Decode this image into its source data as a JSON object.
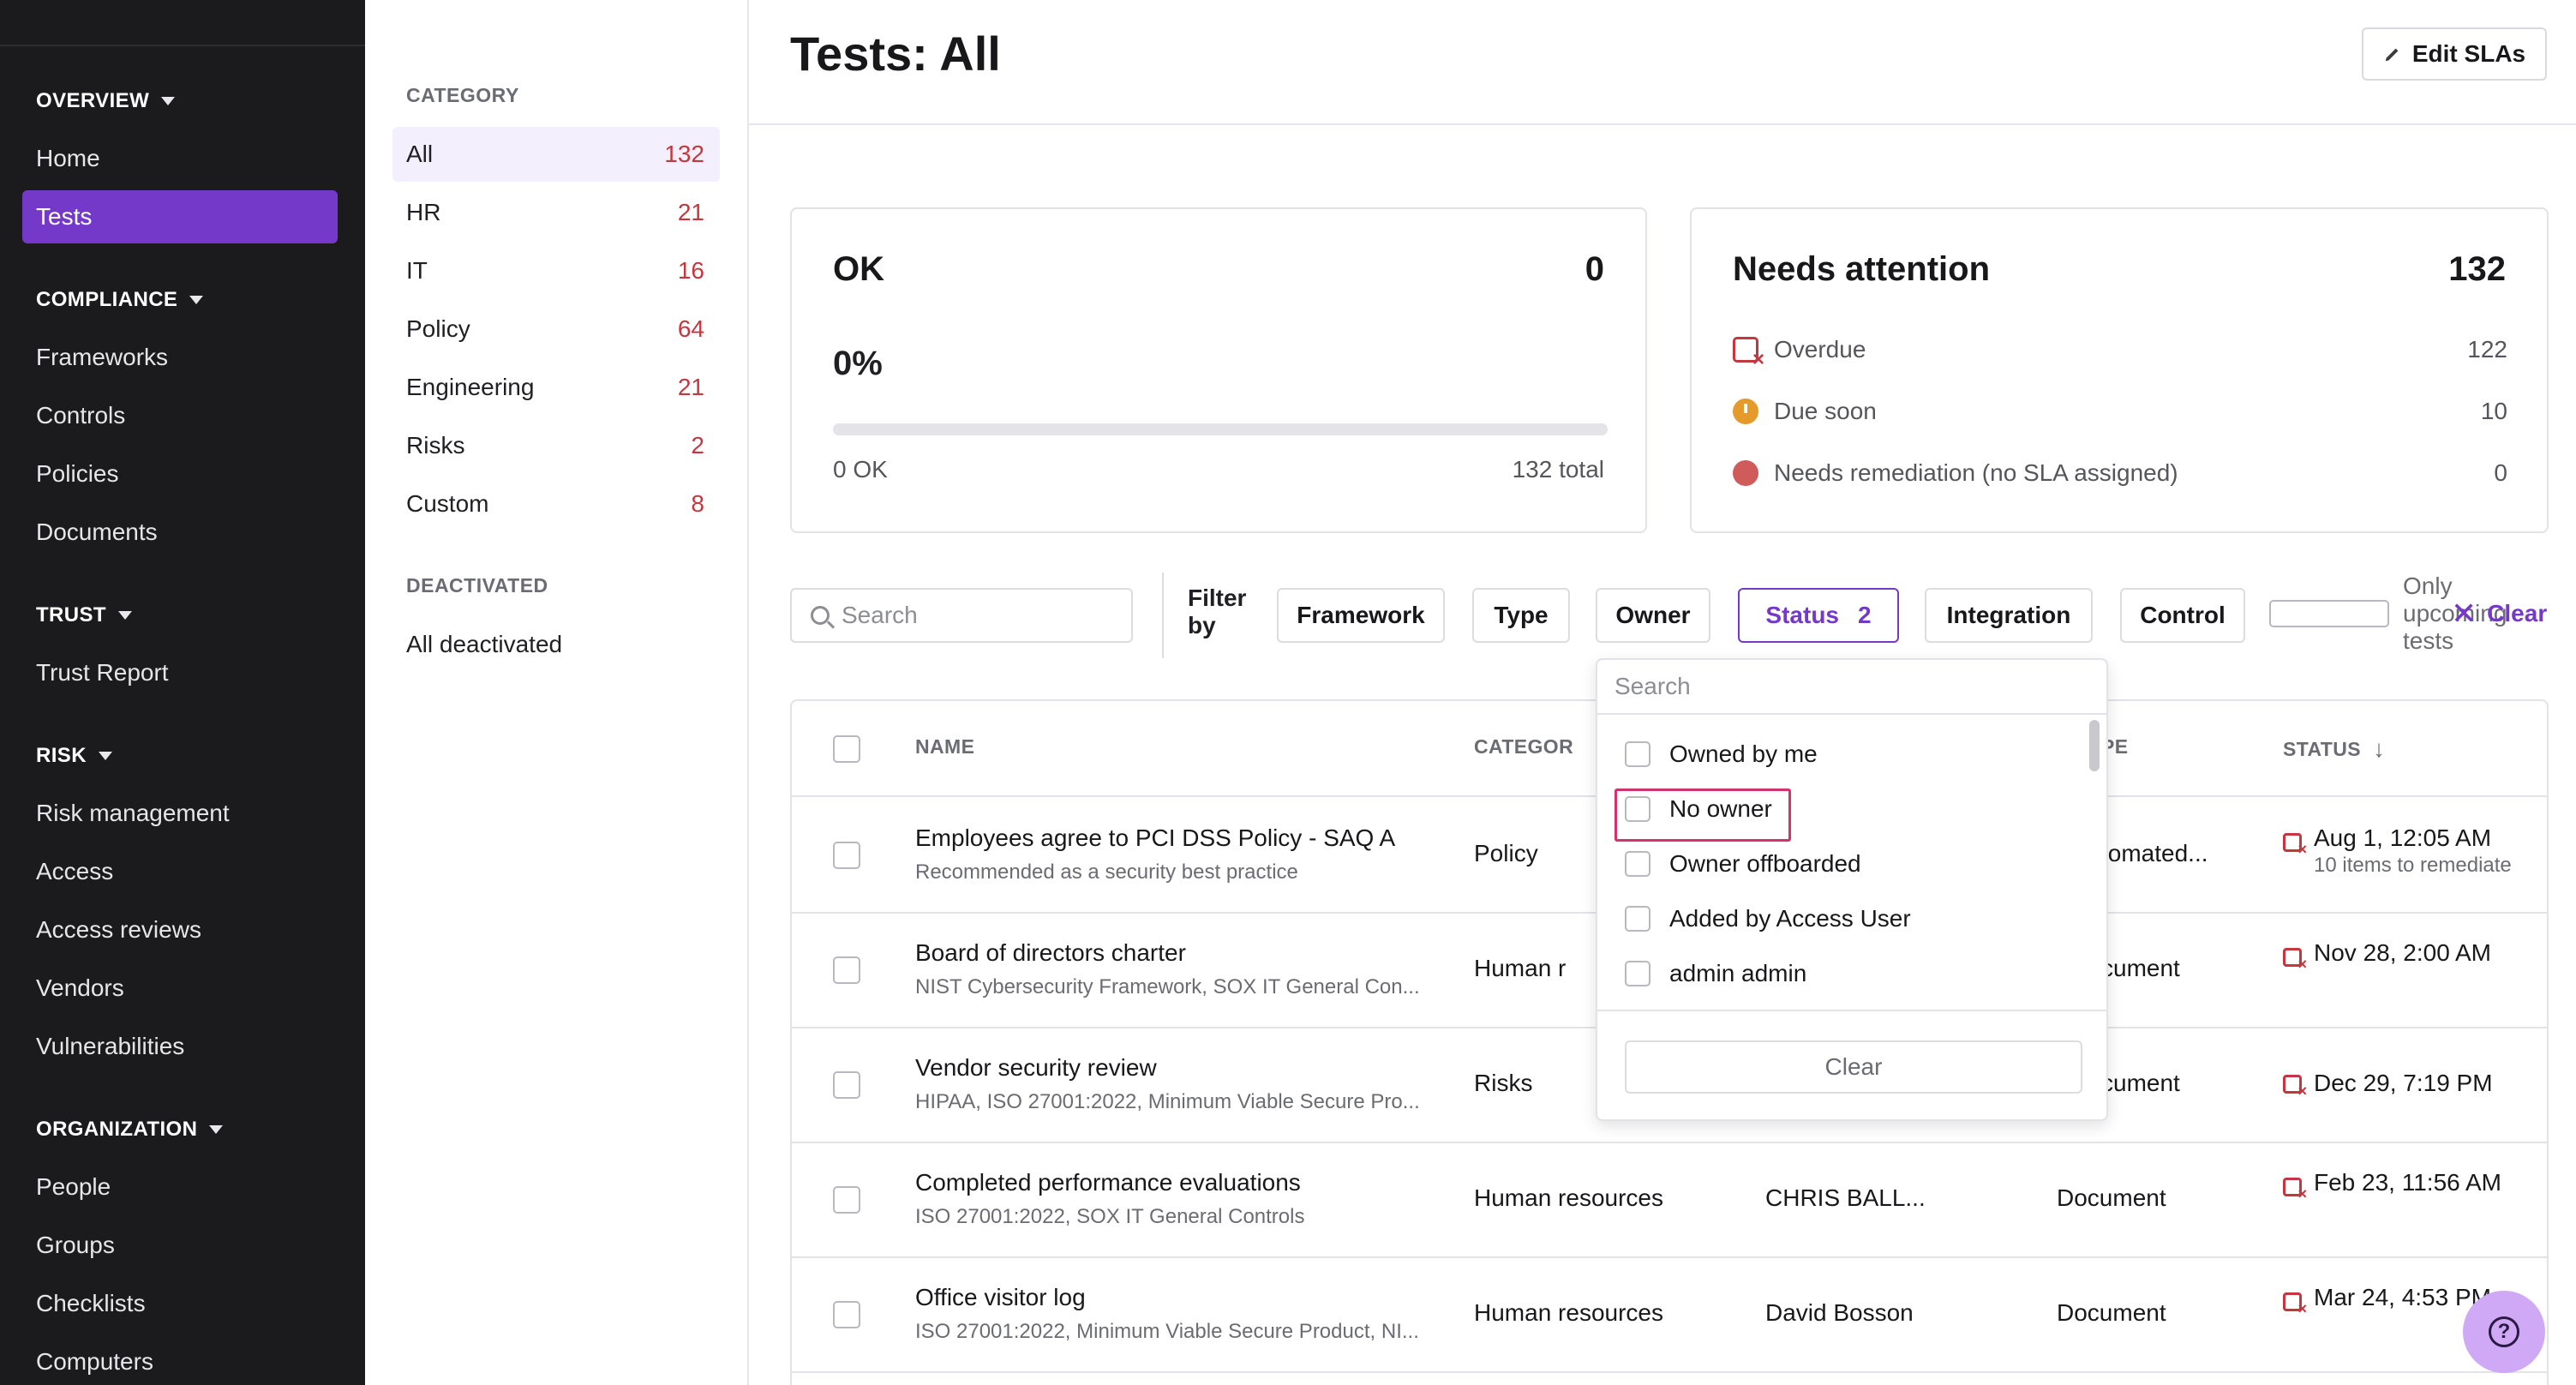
{
  "sidebar": {
    "sections": [
      {
        "title": "OVERVIEW",
        "items": [
          "Home",
          "Tests"
        ]
      },
      {
        "title": "COMPLIANCE",
        "items": [
          "Frameworks",
          "Controls",
          "Policies",
          "Documents"
        ]
      },
      {
        "title": "TRUST",
        "items": [
          "Trust Report"
        ]
      },
      {
        "title": "RISK",
        "items": [
          "Risk management",
          "Access",
          "Access reviews",
          "Vendors",
          "Vulnerabilities"
        ]
      },
      {
        "title": "ORGANIZATION",
        "items": [
          "People",
          "Groups",
          "Checklists",
          "Computers"
        ]
      }
    ],
    "active_item": "Tests"
  },
  "categories": {
    "heading": "CATEGORY",
    "items": [
      {
        "label": "All",
        "count": "132"
      },
      {
        "label": "HR",
        "count": "21"
      },
      {
        "label": "IT",
        "count": "16"
      },
      {
        "label": "Policy",
        "count": "64"
      },
      {
        "label": "Engineering",
        "count": "21"
      },
      {
        "label": "Risks",
        "count": "2"
      },
      {
        "label": "Custom",
        "count": "8"
      }
    ],
    "deactivated_heading": "DEACTIVATED",
    "deactivated_item": "All deactivated"
  },
  "header": {
    "title": "Tests: All",
    "edit_slas": "Edit SLAs"
  },
  "ok_card": {
    "title": "OK",
    "count": "0",
    "percent": "0%",
    "progress_fraction": 0,
    "ok_label": "0 OK",
    "total_label": "132 total"
  },
  "needs_attention": {
    "title": "Needs attention",
    "count": "132",
    "rows": [
      {
        "label": "Overdue",
        "value": "122"
      },
      {
        "label": "Due soon",
        "value": "10"
      },
      {
        "label": "Needs remediation (no SLA assigned)",
        "value": "0"
      }
    ]
  },
  "filters": {
    "search_placeholder": "Search",
    "filter_by": "Filter by",
    "framework": "Framework",
    "type": "Type",
    "owner": "Owner",
    "status": "Status",
    "status_count": "2",
    "integration": "Integration",
    "control": "Control",
    "only_upcoming": "Only upcoming tests",
    "clear": "Clear"
  },
  "table": {
    "headers": {
      "name": "NAME",
      "category": "CATEGOR",
      "type": "PE",
      "status": "STATUS"
    },
    "rows": [
      {
        "name": "Employees agree to PCI DSS Policy - SAQ A",
        "sub": "Recommended as a security best practice",
        "category": "Policy",
        "owner": "",
        "type": "tomated...",
        "status": "Aug 1, 12:05 AM",
        "status_sub": "10 items to remediate"
      },
      {
        "name": "Board of directors charter",
        "sub": "NIST Cybersecurity Framework, SOX IT General Con...",
        "category": "Human r",
        "owner": "",
        "type": "cument",
        "status": "Nov 28, 2:00 AM",
        "status_sub": ""
      },
      {
        "name": "Vendor security review",
        "sub": "HIPAA, ISO 27001:2022, Minimum Viable Secure Pro...",
        "category": "Risks",
        "owner": "",
        "type": "cument",
        "status": "Dec 29, 7:19 PM",
        "status_sub": ""
      },
      {
        "name": "Completed performance evaluations",
        "sub": "ISO 27001:2022, SOX IT General Controls",
        "category": "Human resources",
        "owner": "CHRIS BALL...",
        "type": "Document",
        "status": "Feb 23, 11:56 AM",
        "status_sub": ""
      },
      {
        "name": "Office visitor log",
        "sub": "ISO 27001:2022, Minimum Viable Secure Product, NI...",
        "category": "Human resources",
        "owner": "David Bosson",
        "type": "Document",
        "status": "Mar 24, 4:53 PM",
        "status_sub": ""
      }
    ]
  },
  "owner_dropdown": {
    "search_placeholder": "Search",
    "options": [
      "Owned by me",
      "No owner",
      "Owner offboarded",
      "Added by Access User",
      "admin admin"
    ],
    "clear": "Clear"
  },
  "help_icon": "question-icon",
  "colors": {
    "accent": "#7539c9",
    "danger": "#c4373f",
    "warning": "#e59a2a",
    "highlight": "#d1336a"
  }
}
